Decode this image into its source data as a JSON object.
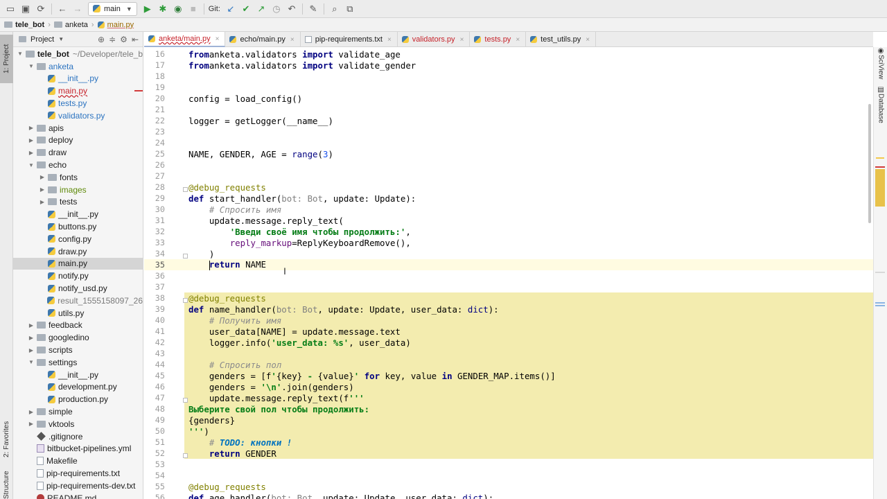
{
  "toolbar": {
    "run_config": "main",
    "git_label": "Git:"
  },
  "breadcrumbs": [
    "tele_bot",
    "anketa",
    "main.py"
  ],
  "left_stripe": {
    "project_tab": "1: Project",
    "favorites_tab": "2: Favorites",
    "structure_tab": "Structure"
  },
  "project_panel": {
    "title": "Project",
    "root_path": "~/Developer/tele_b",
    "items": [
      {
        "label": "tele_bot",
        "level": 0,
        "kind": "root",
        "open": true
      },
      {
        "label": "anketa",
        "level": 1,
        "kind": "folder",
        "open": true,
        "style": "mod"
      },
      {
        "label": "__init__.py",
        "level": 2,
        "kind": "py",
        "style": "mod"
      },
      {
        "label": "main.py",
        "level": 2,
        "kind": "py",
        "style": "err"
      },
      {
        "label": "tests.py",
        "level": 2,
        "kind": "py",
        "style": "mod"
      },
      {
        "label": "validators.py",
        "level": 2,
        "kind": "py",
        "style": "mod"
      },
      {
        "label": "apis",
        "level": 1,
        "kind": "folder",
        "open": false
      },
      {
        "label": "deploy",
        "level": 1,
        "kind": "folder",
        "open": false
      },
      {
        "label": "draw",
        "level": 1,
        "kind": "folder",
        "open": false
      },
      {
        "label": "echo",
        "level": 1,
        "kind": "folder",
        "open": true
      },
      {
        "label": "fonts",
        "level": 2,
        "kind": "folder",
        "open": false
      },
      {
        "label": "images",
        "level": 2,
        "kind": "folder",
        "open": false,
        "style": "green"
      },
      {
        "label": "tests",
        "level": 2,
        "kind": "folder",
        "open": false
      },
      {
        "label": "__init__.py",
        "level": 2,
        "kind": "py"
      },
      {
        "label": "buttons.py",
        "level": 2,
        "kind": "py"
      },
      {
        "label": "config.py",
        "level": 2,
        "kind": "py"
      },
      {
        "label": "draw.py",
        "level": 2,
        "kind": "py"
      },
      {
        "label": "main.py",
        "level": 2,
        "kind": "py",
        "selected": true
      },
      {
        "label": "notify.py",
        "level": 2,
        "kind": "py"
      },
      {
        "label": "notify_usd.py",
        "level": 2,
        "kind": "py"
      },
      {
        "label": "result_1555158097_26",
        "level": 2,
        "kind": "py",
        "style": "gray"
      },
      {
        "label": "utils.py",
        "level": 2,
        "kind": "py"
      },
      {
        "label": "feedback",
        "level": 1,
        "kind": "folder",
        "open": false
      },
      {
        "label": "googledino",
        "level": 1,
        "kind": "folder",
        "open": false
      },
      {
        "label": "scripts",
        "level": 1,
        "kind": "folder",
        "open": false
      },
      {
        "label": "settings",
        "level": 1,
        "kind": "folder",
        "open": true
      },
      {
        "label": "__init__.py",
        "level": 2,
        "kind": "py"
      },
      {
        "label": "development.py",
        "level": 2,
        "kind": "py"
      },
      {
        "label": "production.py",
        "level": 2,
        "kind": "py"
      },
      {
        "label": "simple",
        "level": 1,
        "kind": "folder",
        "open": false
      },
      {
        "label": "vktools",
        "level": 1,
        "kind": "folder",
        "open": false
      },
      {
        "label": ".gitignore",
        "level": 1,
        "kind": "git"
      },
      {
        "label": "bitbucket-pipelines.yml",
        "level": 1,
        "kind": "yml"
      },
      {
        "label": "Makefile",
        "level": 1,
        "kind": "txt"
      },
      {
        "label": "pip-requirements.txt",
        "level": 1,
        "kind": "txt"
      },
      {
        "label": "pip-requirements-dev.txt",
        "level": 1,
        "kind": "txt"
      },
      {
        "label": "README.md",
        "level": 1,
        "kind": "md"
      }
    ]
  },
  "tabs": [
    {
      "label": "anketa/main.py",
      "active": true,
      "icon": "py"
    },
    {
      "label": "echo/main.py",
      "icon": "py"
    },
    {
      "label": "pip-requirements.txt",
      "icon": "txt"
    },
    {
      "label": "validators.py",
      "icon": "py",
      "error": true
    },
    {
      "label": "tests.py",
      "icon": "py",
      "error": true
    },
    {
      "label": "test_utils.py",
      "icon": "py"
    }
  ],
  "editor": {
    "current_line": 35,
    "lines": [
      {
        "n": 16,
        "t": [
          [
            "kw",
            "from"
          ],
          [
            "",
            "anketa.validators "
          ],
          [
            "kw",
            "import"
          ],
          [
            "",
            " validate_age"
          ]
        ]
      },
      {
        "n": 17,
        "t": [
          [
            "kw",
            "from"
          ],
          [
            "",
            "anketa.validators "
          ],
          [
            "kw",
            "import"
          ],
          [
            "",
            " validate_gender"
          ]
        ]
      },
      {
        "n": 18,
        "t": []
      },
      {
        "n": 19,
        "t": []
      },
      {
        "n": 20,
        "t": [
          [
            "",
            "config = load_config()"
          ]
        ]
      },
      {
        "n": 21,
        "t": []
      },
      {
        "n": 22,
        "t": [
          [
            "",
            "logger = getLogger("
          ],
          [
            "",
            "__name__"
          ],
          [
            "",
            ")"
          ]
        ]
      },
      {
        "n": 23,
        "t": []
      },
      {
        "n": 24,
        "t": []
      },
      {
        "n": 25,
        "t": [
          [
            "",
            "NAME, GENDER, AGE = "
          ],
          [
            "builtin",
            "range"
          ],
          [
            "",
            "("
          ],
          [
            "num",
            "3"
          ],
          [
            "",
            ")"
          ]
        ]
      },
      {
        "n": 26,
        "t": []
      },
      {
        "n": 27,
        "t": []
      },
      {
        "n": 28,
        "t": [
          [
            "dec",
            "@debug_requests"
          ]
        ]
      },
      {
        "n": 29,
        "t": [
          [
            "kw",
            "def"
          ],
          [
            "",
            " start_handler("
          ],
          [
            "ann",
            "bot: Bot"
          ],
          [
            "",
            ", update: Update):"
          ]
        ]
      },
      {
        "n": 30,
        "t": [
          [
            "",
            "    "
          ],
          [
            "cmt",
            "# Спросить имя"
          ]
        ]
      },
      {
        "n": 31,
        "t": [
          [
            "",
            "    update.message.reply_text("
          ]
        ]
      },
      {
        "n": 32,
        "t": [
          [
            "",
            "        "
          ],
          [
            "str",
            "'Введи своё имя чтобы продолжить:'"
          ],
          [
            "",
            ","
          ]
        ]
      },
      {
        "n": 33,
        "t": [
          [
            "",
            "        "
          ],
          [
            "param",
            "reply_markup"
          ],
          [
            "",
            "=ReplyKeyboardRemove(),"
          ]
        ]
      },
      {
        "n": 34,
        "t": [
          [
            "",
            "    )"
          ]
        ]
      },
      {
        "n": 35,
        "t": [
          [
            "",
            "    "
          ],
          [
            "caret",
            ""
          ],
          [
            "kw",
            "return"
          ],
          [
            "",
            " NAME"
          ]
        ]
      },
      {
        "n": 36,
        "t": []
      },
      {
        "n": 37,
        "t": []
      },
      {
        "n": 38,
        "t": [
          [
            "dec",
            "@debug_requests"
          ]
        ],
        "hl": true
      },
      {
        "n": 39,
        "t": [
          [
            "kw",
            "def"
          ],
          [
            "",
            " name_handler("
          ],
          [
            "ann",
            "bot: Bot"
          ],
          [
            "",
            ", update: Update, user_data: "
          ],
          [
            "builtin",
            "dict"
          ],
          [
            "",
            "):"
          ]
        ],
        "hl": true
      },
      {
        "n": 40,
        "t": [
          [
            "",
            "    "
          ],
          [
            "cmt",
            "# Получить имя"
          ]
        ],
        "hl": true
      },
      {
        "n": 41,
        "t": [
          [
            "",
            "    user_data[NAME] = update.message.text"
          ]
        ],
        "hl": true
      },
      {
        "n": 42,
        "t": [
          [
            "",
            "    logger.info("
          ],
          [
            "str",
            "'user_data: %s'"
          ],
          [
            "",
            ", user_data)"
          ]
        ],
        "hl": true
      },
      {
        "n": 43,
        "t": [],
        "hl": true
      },
      {
        "n": 44,
        "t": [
          [
            "",
            "    "
          ],
          [
            "cmt",
            "# Спросить пол"
          ]
        ],
        "hl": true
      },
      {
        "n": 45,
        "t": [
          [
            "",
            "    genders = [f"
          ],
          [
            "str",
            "'"
          ],
          [
            "",
            "{key}"
          ],
          [
            "str",
            " - "
          ],
          [
            "",
            "{value}"
          ],
          [
            "str",
            "'"
          ],
          [
            "",
            " "
          ],
          [
            "kw",
            "for"
          ],
          [
            "",
            " key, value "
          ],
          [
            "kw",
            "in"
          ],
          [
            "",
            " GENDER_MAP.items()]"
          ]
        ],
        "hl": true
      },
      {
        "n": 46,
        "t": [
          [
            "",
            "    genders = "
          ],
          [
            "str",
            "'\\n'"
          ],
          [
            "",
            ".join(genders)"
          ]
        ],
        "hl": true
      },
      {
        "n": 47,
        "t": [
          [
            "",
            "    update.message.reply_text(f"
          ],
          [
            "str",
            "'''"
          ]
        ],
        "hl": true
      },
      {
        "n": 48,
        "t": [
          [
            "str",
            "Выберите свой пол чтобы продолжить:"
          ]
        ],
        "hl": true
      },
      {
        "n": 49,
        "t": [
          [
            "",
            "{genders}"
          ]
        ],
        "hl": true
      },
      {
        "n": 50,
        "t": [
          [
            "str",
            "'''"
          ],
          [
            "",
            ")"
          ]
        ],
        "hl": true
      },
      {
        "n": 51,
        "t": [
          [
            "",
            "    "
          ],
          [
            "cmt",
            "# "
          ],
          [
            "todo",
            "TODO: кнопки !"
          ]
        ],
        "hl": true
      },
      {
        "n": 52,
        "t": [
          [
            "",
            "    "
          ],
          [
            "kw",
            "return"
          ],
          [
            "",
            " GENDER"
          ]
        ],
        "hl": true
      },
      {
        "n": 53,
        "t": []
      },
      {
        "n": 54,
        "t": []
      },
      {
        "n": 55,
        "t": [
          [
            "dec",
            "@debug_requests"
          ]
        ]
      },
      {
        "n": 56,
        "t": [
          [
            "kw",
            "def"
          ],
          [
            "",
            " age_handler("
          ],
          [
            "ann",
            "bot: Bot"
          ],
          [
            "",
            ", update: Update, user_data: "
          ],
          [
            "builtin",
            "dict"
          ],
          [
            "",
            "):"
          ]
        ]
      }
    ]
  },
  "right_tools": {
    "sciview": "SciView",
    "database": "Database"
  }
}
